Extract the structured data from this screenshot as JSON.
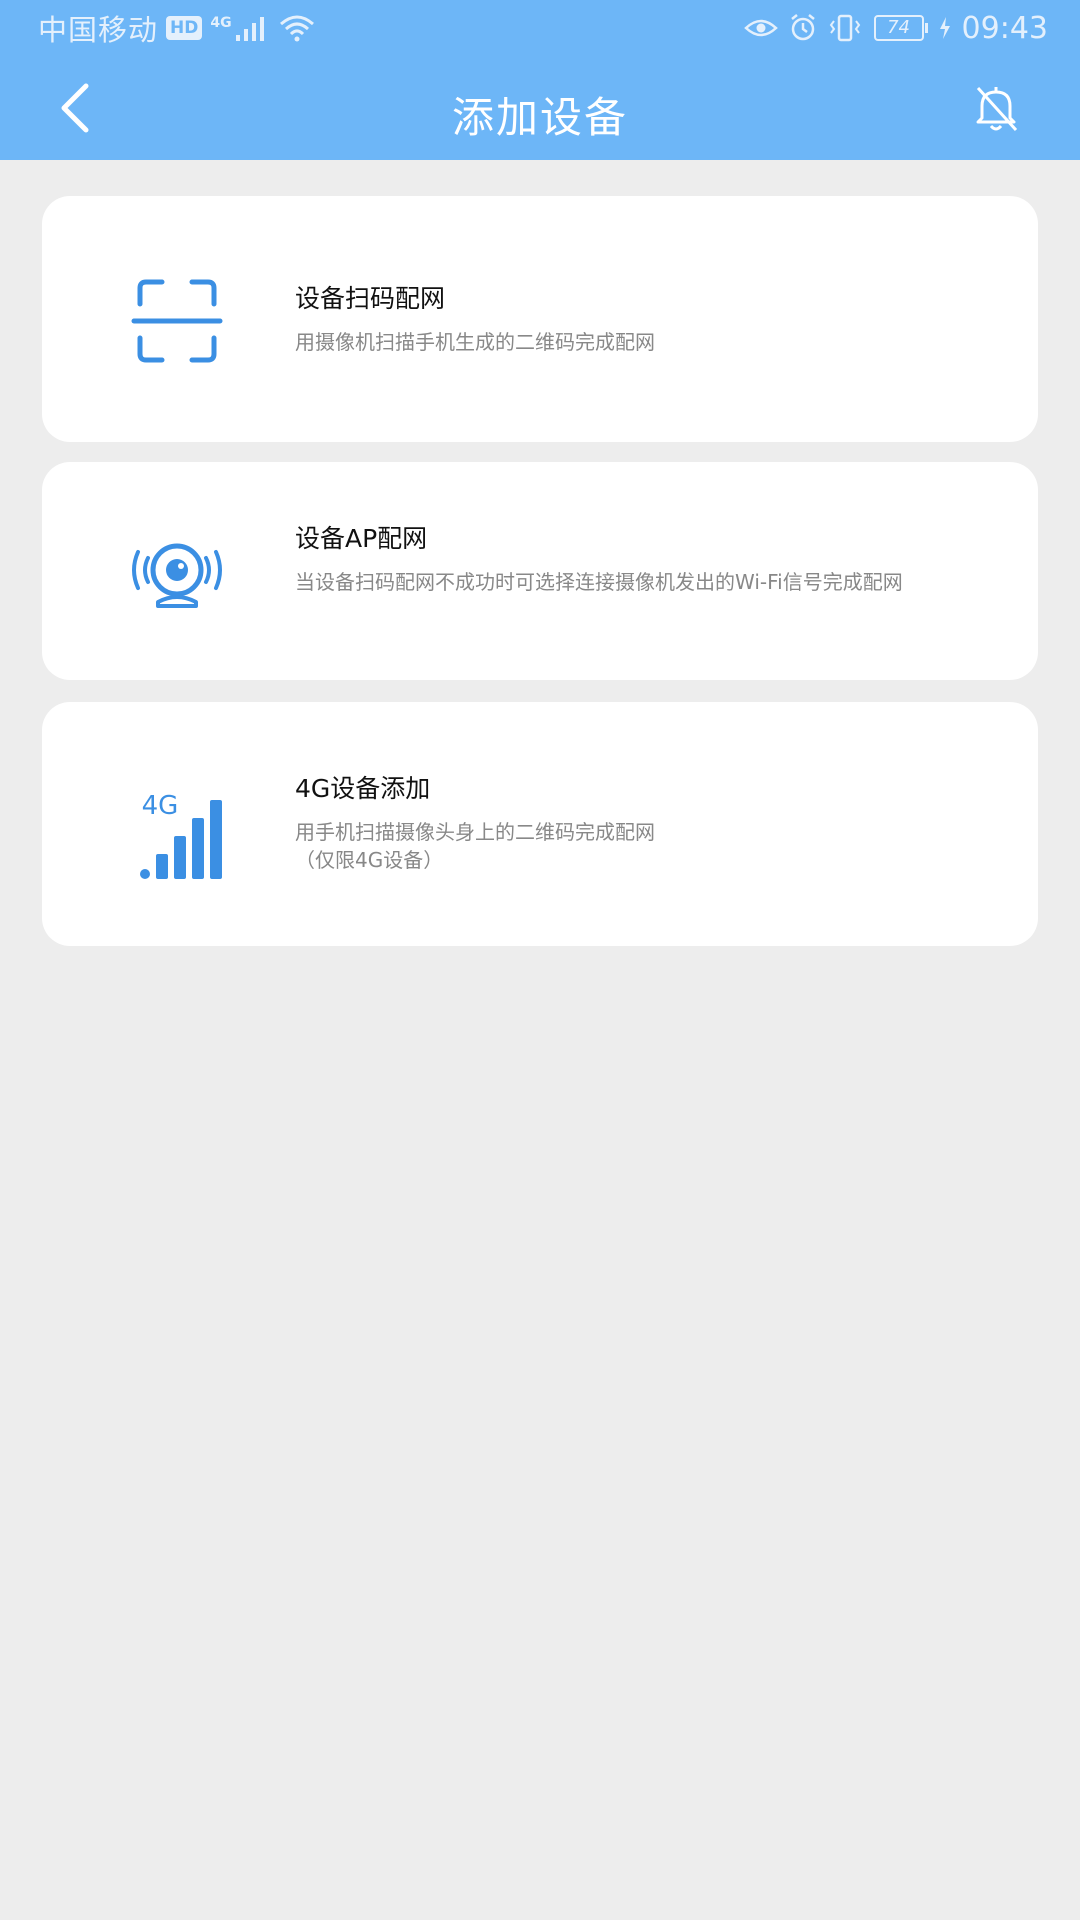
{
  "status_bar": {
    "carrier": "中国移动",
    "hd": "HD",
    "network": "4G",
    "battery": "74",
    "time": "09:43"
  },
  "header": {
    "title": "添加设备"
  },
  "options": [
    {
      "title": "设备扫码配网",
      "desc": "用摄像机扫描手机生成的二维码完成配网"
    },
    {
      "title": "设备AP配网",
      "desc": "当设备扫码配网不成功时可选择连接摄像机发出的Wi-Fi信号完成配网"
    },
    {
      "title": "4G设备添加",
      "desc": "用手机扫描摄像头身上的二维码完成配网\n（仅限4G设备）",
      "icon_label": "4G"
    }
  ],
  "colors": {
    "header": "#6db6f7",
    "icon": "#3b8fe3",
    "background": "#ededed"
  }
}
